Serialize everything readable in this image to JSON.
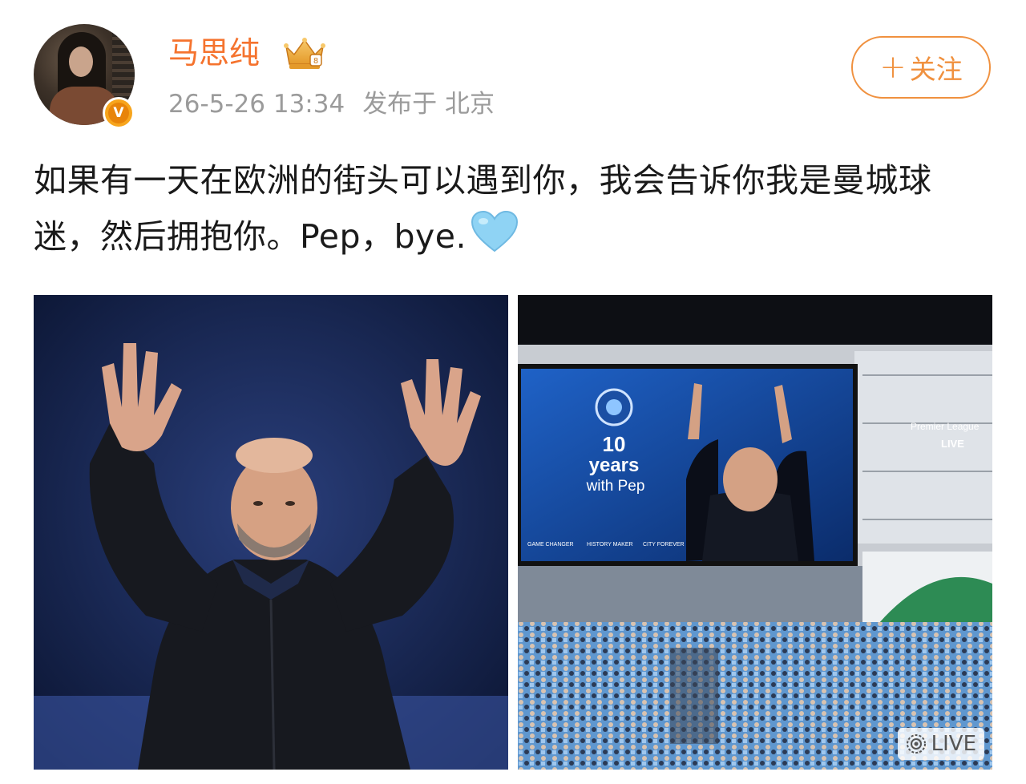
{
  "author": {
    "name": "马思纯",
    "verified_badge": "V",
    "crown_badge": "crown-icon"
  },
  "meta": {
    "time": "26-5-26 13:34",
    "location": "发布于 北京"
  },
  "follow_button": {
    "plus": "+",
    "label": "关注"
  },
  "post": {
    "text": "如果有一天在欧洲的街头可以遇到你，我会告诉你我是曼城球迷，然后拥抱你。Pep，bye.",
    "emoji": "light-blue-heart"
  },
  "images": [
    {
      "alt_icon": "photo",
      "caption": ""
    },
    {
      "screen_number": "10",
      "screen_line1": "years",
      "screen_line2": "with Pep",
      "screen_footer": [
        "GAME CHANGER",
        "HISTORY MAKER",
        "CITY FOREVER"
      ],
      "broadcast_tag": "Premier League",
      "broadcast_live": "LIVE",
      "live_badge": "LIVE"
    }
  ],
  "colors": {
    "brand_orange": "#f5732e",
    "follow_border": "#f0913f",
    "meta_gray": "#9b9b9b",
    "text": "#1a1a1a",
    "heart": "#8fd3f4"
  }
}
